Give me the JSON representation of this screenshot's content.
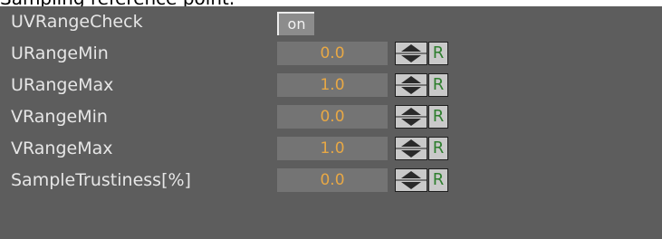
{
  "caption": "Sampling reference point.",
  "rows": [
    {
      "label": "UVRangeCheck",
      "toggle": "on"
    },
    {
      "label": "URangeMin",
      "value": "0.0",
      "reset": "R"
    },
    {
      "label": "URangeMax",
      "value": "1.0",
      "reset": "R"
    },
    {
      "label": "VRangeMin",
      "value": "0.0",
      "reset": "R"
    },
    {
      "label": "VRangeMax",
      "value": "1.0",
      "reset": "R"
    },
    {
      "label": "SampleTrustiness[%]",
      "value": "0.0",
      "reset": "R"
    }
  ],
  "icons": {
    "spinner": "up-down-spinner-icon"
  },
  "colors": {
    "panel": "#5d5d5d",
    "field": "#747474",
    "value_text": "#e8a845",
    "reset_text": "#2f7f2f"
  }
}
